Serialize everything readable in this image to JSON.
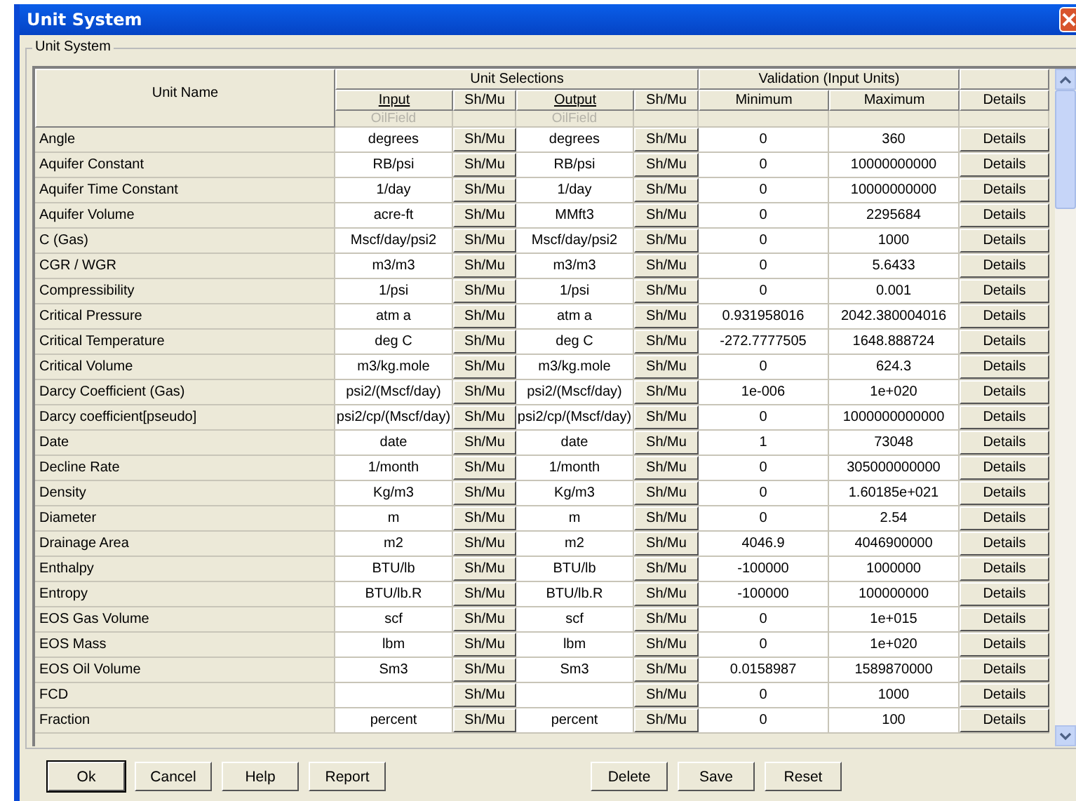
{
  "window": {
    "title": "Unit System"
  },
  "group_title": "Unit System",
  "table": {
    "name_heading": "Unit Name",
    "unit_selections": "Unit Selections",
    "validation": "Validation (Input Units)",
    "columns": [
      "Input",
      "Sh/Mu",
      "Output",
      "Sh/Mu",
      "Minimum",
      "Maximum",
      "Details"
    ],
    "input_system": "OilField",
    "output_system": "OilField",
    "rows": [
      {
        "name": "Angle",
        "input": "degrees",
        "input_button": "Sh/Mu",
        "output": "degrees",
        "output_button": "Sh/Mu",
        "minimum": "0",
        "maximum": "360",
        "details": "Details"
      },
      {
        "name": "Aquifer Constant",
        "input": "RB/psi",
        "input_button": "Sh/Mu",
        "output": "RB/psi",
        "output_button": "Sh/Mu",
        "minimum": "0",
        "maximum": "10000000000",
        "details": "Details"
      },
      {
        "name": "Aquifer Time Constant",
        "input": "1/day",
        "input_button": "Sh/Mu",
        "output": "1/day",
        "output_button": "Sh/Mu",
        "minimum": "0",
        "maximum": "10000000000",
        "details": "Details"
      },
      {
        "name": "Aquifer Volume",
        "input": "acre-ft",
        "input_button": "Sh/Mu",
        "output": "MMft3",
        "output_button": "Sh/Mu",
        "minimum": "0",
        "maximum": "2295684",
        "details": "Details"
      },
      {
        "name": "C (Gas)",
        "input": "Mscf/day/psi2",
        "input_button": "Sh/Mu",
        "output": "Mscf/day/psi2",
        "output_button": "Sh/Mu",
        "minimum": "0",
        "maximum": "1000",
        "details": "Details"
      },
      {
        "name": "CGR / WGR",
        "input": "m3/m3",
        "input_button": "Sh/Mu",
        "output": "m3/m3",
        "output_button": "Sh/Mu",
        "minimum": "0",
        "maximum": "5.6433",
        "details": "Details"
      },
      {
        "name": "Compressibility",
        "input": "1/psi",
        "input_button": "Sh/Mu",
        "output": "1/psi",
        "output_button": "Sh/Mu",
        "minimum": "0",
        "maximum": "0.001",
        "details": "Details"
      },
      {
        "name": "Critical Pressure",
        "input": "atm a",
        "input_button": "Sh/Mu",
        "output": "atm a",
        "output_button": "Sh/Mu",
        "minimum": "0.931958016",
        "maximum": "2042.380004016",
        "details": "Details"
      },
      {
        "name": "Critical Temperature",
        "input": "deg C",
        "input_button": "Sh/Mu",
        "output": "deg C",
        "output_button": "Sh/Mu",
        "minimum": "-272.7777505",
        "maximum": "1648.888724",
        "details": "Details"
      },
      {
        "name": "Critical Volume",
        "input": "m3/kg.mole",
        "input_button": "Sh/Mu",
        "output": "m3/kg.mole",
        "output_button": "Sh/Mu",
        "minimum": "0",
        "maximum": "624.3",
        "details": "Details"
      },
      {
        "name": "Darcy Coefficient (Gas)",
        "input": "psi2/(Mscf/day)",
        "input_button": "Sh/Mu",
        "output": "psi2/(Mscf/day)",
        "output_button": "Sh/Mu",
        "minimum": "1e-006",
        "maximum": "1e+020",
        "details": "Details"
      },
      {
        "name": "Darcy coefficient[pseudo]",
        "input": "psi2/cp/(Mscf/day)",
        "input_button": "Sh/Mu",
        "output": "psi2/cp/(Mscf/day)",
        "output_button": "Sh/Mu",
        "minimum": "0",
        "maximum": "1000000000000",
        "details": "Details"
      },
      {
        "name": "Date",
        "input": "date",
        "input_button": "Sh/Mu",
        "output": "date",
        "output_button": "Sh/Mu",
        "minimum": "1",
        "maximum": "73048",
        "details": "Details"
      },
      {
        "name": "Decline Rate",
        "input": "1/month",
        "input_button": "Sh/Mu",
        "output": "1/month",
        "output_button": "Sh/Mu",
        "minimum": "0",
        "maximum": "305000000000",
        "details": "Details"
      },
      {
        "name": "Density",
        "input": "Kg/m3",
        "input_button": "Sh/Mu",
        "output": "Kg/m3",
        "output_button": "Sh/Mu",
        "minimum": "0",
        "maximum": "1.60185e+021",
        "details": "Details"
      },
      {
        "name": "Diameter",
        "input": "m",
        "input_button": "Sh/Mu",
        "output": "m",
        "output_button": "Sh/Mu",
        "minimum": "0",
        "maximum": "2.54",
        "details": "Details"
      },
      {
        "name": "Drainage Area",
        "input": "m2",
        "input_button": "Sh/Mu",
        "output": "m2",
        "output_button": "Sh/Mu",
        "minimum": "4046.9",
        "maximum": "4046900000",
        "details": "Details"
      },
      {
        "name": "Enthalpy",
        "input": "BTU/lb",
        "input_button": "Sh/Mu",
        "output": "BTU/lb",
        "output_button": "Sh/Mu",
        "minimum": "-100000",
        "maximum": "1000000",
        "details": "Details"
      },
      {
        "name": "Entropy",
        "input": "BTU/lb.R",
        "input_button": "Sh/Mu",
        "output": "BTU/lb.R",
        "output_button": "Sh/Mu",
        "minimum": "-100000",
        "maximum": "100000000",
        "details": "Details"
      },
      {
        "name": "EOS Gas Volume",
        "input": "scf",
        "input_button": "Sh/Mu",
        "output": "scf",
        "output_button": "Sh/Mu",
        "minimum": "0",
        "maximum": "1e+015",
        "details": "Details"
      },
      {
        "name": "EOS Mass",
        "input": "lbm",
        "input_button": "Sh/Mu",
        "output": "lbm",
        "output_button": "Sh/Mu",
        "minimum": "0",
        "maximum": "1e+020",
        "details": "Details"
      },
      {
        "name": "EOS Oil Volume",
        "input": "Sm3",
        "input_button": "Sh/Mu",
        "output": "Sm3",
        "output_button": "Sh/Mu",
        "minimum": "0.0158987",
        "maximum": "1589870000",
        "details": "Details"
      },
      {
        "name": "FCD",
        "input_button": "Sh/Mu",
        "output_button": "Sh/Mu",
        "minimum": "0",
        "maximum": "1000",
        "details": "Details"
      },
      {
        "name": "Fraction",
        "input": "percent",
        "input_button": "Sh/Mu",
        "output": "percent",
        "output_button": "Sh/Mu",
        "minimum": "0",
        "maximum": "100",
        "details": "Details"
      }
    ]
  },
  "buttons_left": [
    {
      "label": "Ok",
      "default": true
    },
    {
      "label": "Cancel",
      "default": false
    },
    {
      "label": "Help",
      "default": false
    },
    {
      "label": "Report",
      "default": false
    }
  ],
  "buttons_right": [
    {
      "label": "Delete",
      "default": false
    },
    {
      "label": "Save",
      "default": false
    },
    {
      "label": "Reset",
      "default": false
    }
  ]
}
